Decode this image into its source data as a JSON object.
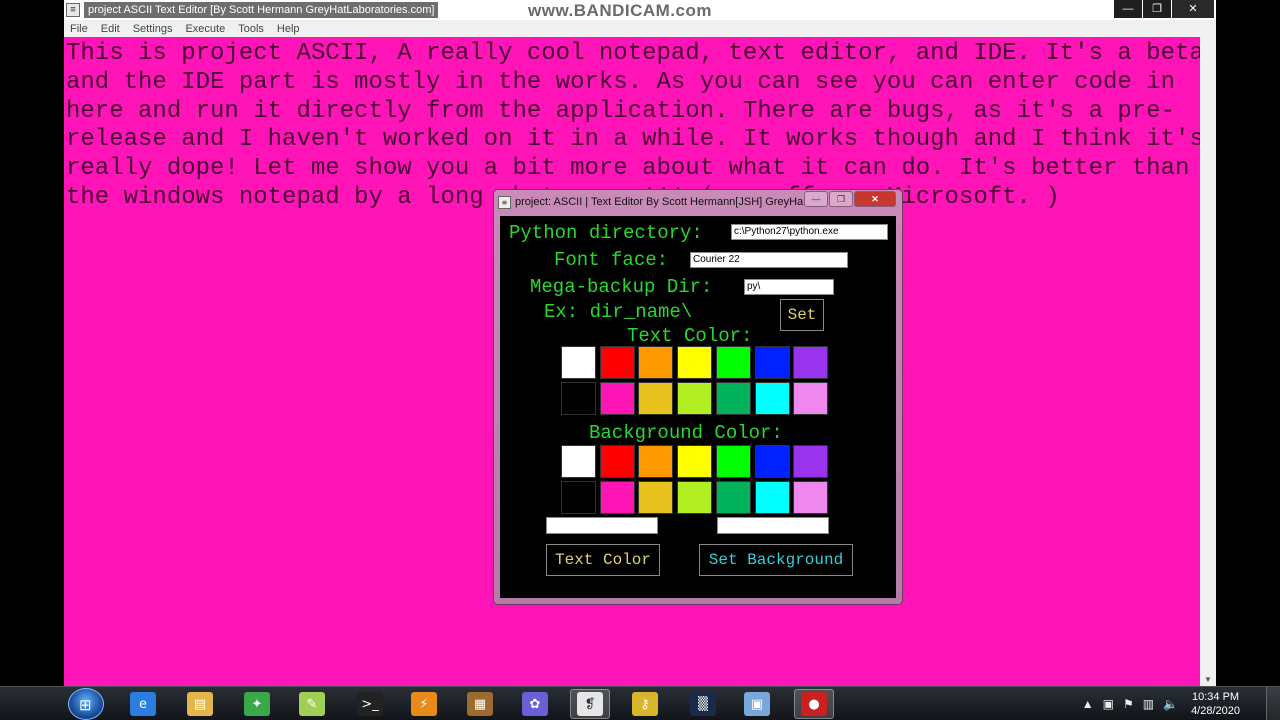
{
  "window": {
    "title": "project ASCII Text Editor [By Scott Hermann GreyHatLaboratories.com]",
    "watermark": "www.BANDICAM.com",
    "minimize": "—",
    "maximize": "❐",
    "close": "✕"
  },
  "menu": [
    "File",
    "Edit",
    "Settings",
    "Execute",
    "Tools",
    "Help"
  ],
  "editor": {
    "text": "This is project ASCII, A really cool notepad, text editor, and IDE. It's a beta and the IDE part is mostly in the works. As you can see you can enter code in here and run it directly from the application. There are bugs, as it's a pre-release and I haven't worked on it in a while. It works though and I think it's really dope! Let me show you a bit more about what it can do. It's better than the windows notepad by a long shot, some!!! ( no offense Microsoft. )",
    "background": "#ff14b8",
    "text_color": "#4a0033"
  },
  "dialog": {
    "title": "project: ASCII | Text Editor By Scott Hermann[JSH] GreyHa...",
    "python_dir_label": "Python directory:",
    "python_dir_value": "c:\\Python27\\python.exe",
    "font_face_label": "Font face:",
    "font_face_value": "Courier 22",
    "backup_label": "Mega-backup Dir:",
    "backup_value": "py\\",
    "example_label": "Ex: dir_name\\",
    "set_button": "Set",
    "text_color_label": "Text Color:",
    "background_color_label": "Background Color:",
    "text_color_button": "Text Color",
    "set_background_button": "Set Background",
    "palette_row1": [
      "#ffffff",
      "#ff0000",
      "#ff9900",
      "#ffff00",
      "#00ff00",
      "#0022ff",
      "#9933ee"
    ],
    "palette_row2": [
      "#000000",
      "#ff14b8",
      "#e6c21e",
      "#b2ef22",
      "#00b35a",
      "#00ffff",
      "#ee88ee"
    ]
  },
  "taskbar": {
    "icons": [
      "ie-icon",
      "folder-icon",
      "media-icon",
      "notepad-icon",
      "cmd-icon",
      "winamp-icon",
      "dosbox-icon",
      "app-icon",
      "python-editor-icon",
      "keys-icon",
      "terminal-icon",
      "image-icon",
      "record-icon"
    ],
    "time": "10:34 PM",
    "date": "4/28/2020"
  }
}
